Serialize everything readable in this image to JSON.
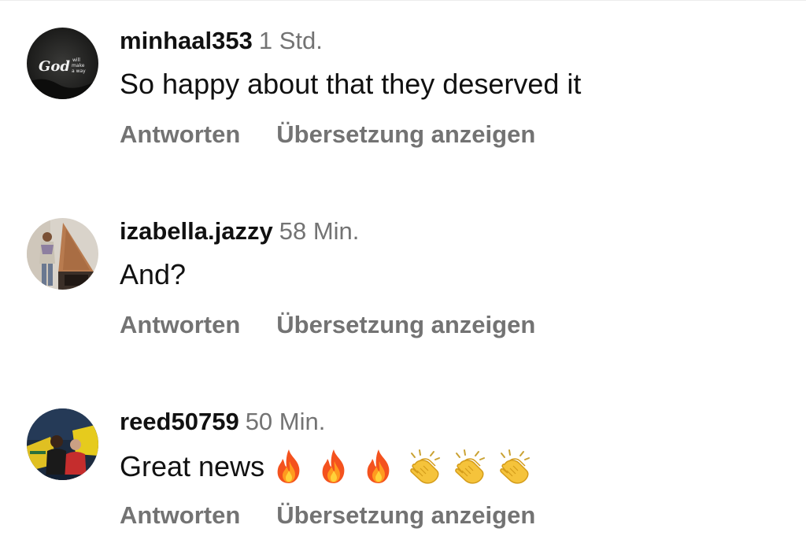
{
  "comments": [
    {
      "username": "minhaal353",
      "time": "1 Std.",
      "text": "So happy about that they deserved it",
      "avatar_text": {
        "big": "God",
        "small1": "will",
        "small2": "make",
        "small3": "a way"
      },
      "reply_label": "Antworten",
      "translate_label": "Übersetzung anzeigen"
    },
    {
      "username": "izabella.jazzy",
      "time": "58 Min.",
      "text": "And?",
      "reply_label": "Antworten",
      "translate_label": "Übersetzung anzeigen"
    },
    {
      "username": "reed50759",
      "time": "50 Min.",
      "text": "Great news",
      "emojis": [
        "fire-emoji",
        "fire-emoji",
        "fire-emoji",
        "clapping-hands-emoji",
        "clapping-hands-emoji",
        "clapping-hands-emoji"
      ],
      "reply_label": "Antworten",
      "translate_label": "Übersetzung anzeigen"
    }
  ],
  "colors": {
    "text": "#111111",
    "secondary": "#737373",
    "divider": "#ececec",
    "background": "#ffffff"
  }
}
